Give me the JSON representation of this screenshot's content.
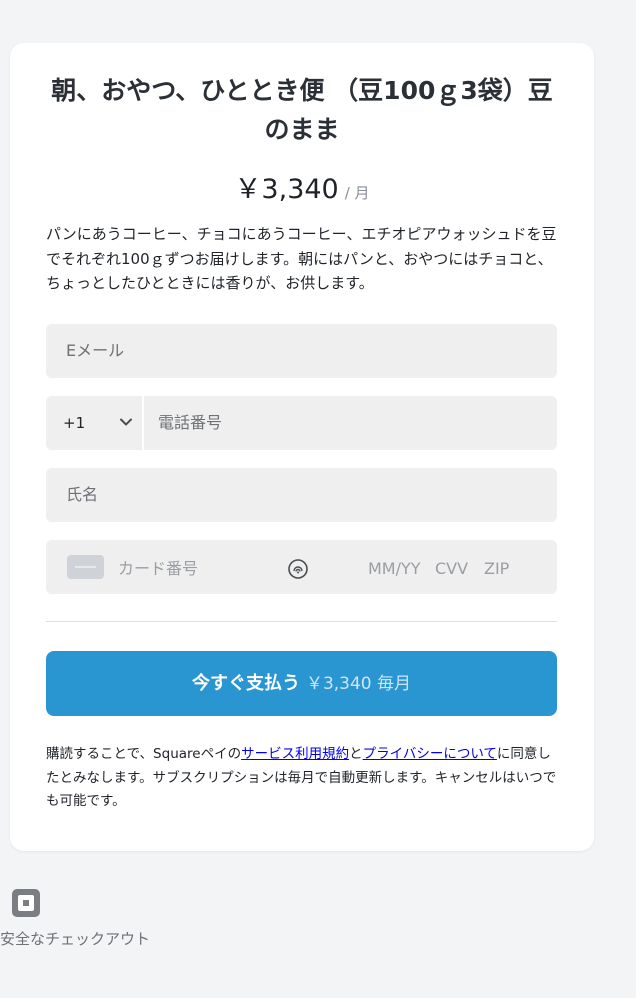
{
  "product": {
    "title": "朝、おやつ、ひととき便 （豆100ｇ3袋）豆のまま",
    "price": "￥3,340",
    "period": "/ 月",
    "description": "パンにあうコーヒー、チョコにあうコーヒー、エチオピアウォッシュドを豆でそれぞれ100ｇずつお届けします。朝にはパンと、おやつにはチョコと、ちょっとしたひとときには香りが、お供します。"
  },
  "form": {
    "email_placeholder": "Eメール",
    "country_code": "+1",
    "phone_placeholder": "電話番号",
    "name_placeholder": "氏名",
    "card_number_placeholder": "カード番号",
    "expiry_placeholder": "MM/YY",
    "cvv_placeholder": "CVV",
    "zip_placeholder": "ZIP"
  },
  "pay_button": {
    "label": "今すぐ支払う",
    "amount": "￥3,340 毎月"
  },
  "legal": {
    "text_before": "購読することで、Squareペイの",
    "terms_link": "サービス利用規約",
    "and": "と",
    "privacy_link": "プライバシーについて",
    "text_after": "に同意したとみなします。サブスクリプションは毎月で自動更新します。キャンセルはいつでも可能です。"
  },
  "footer": {
    "secure_label": "安全なチェックアウト"
  },
  "colors": {
    "accent": "#2995d1",
    "field_bg": "#efefef",
    "page_bg": "#f3f4f6"
  }
}
